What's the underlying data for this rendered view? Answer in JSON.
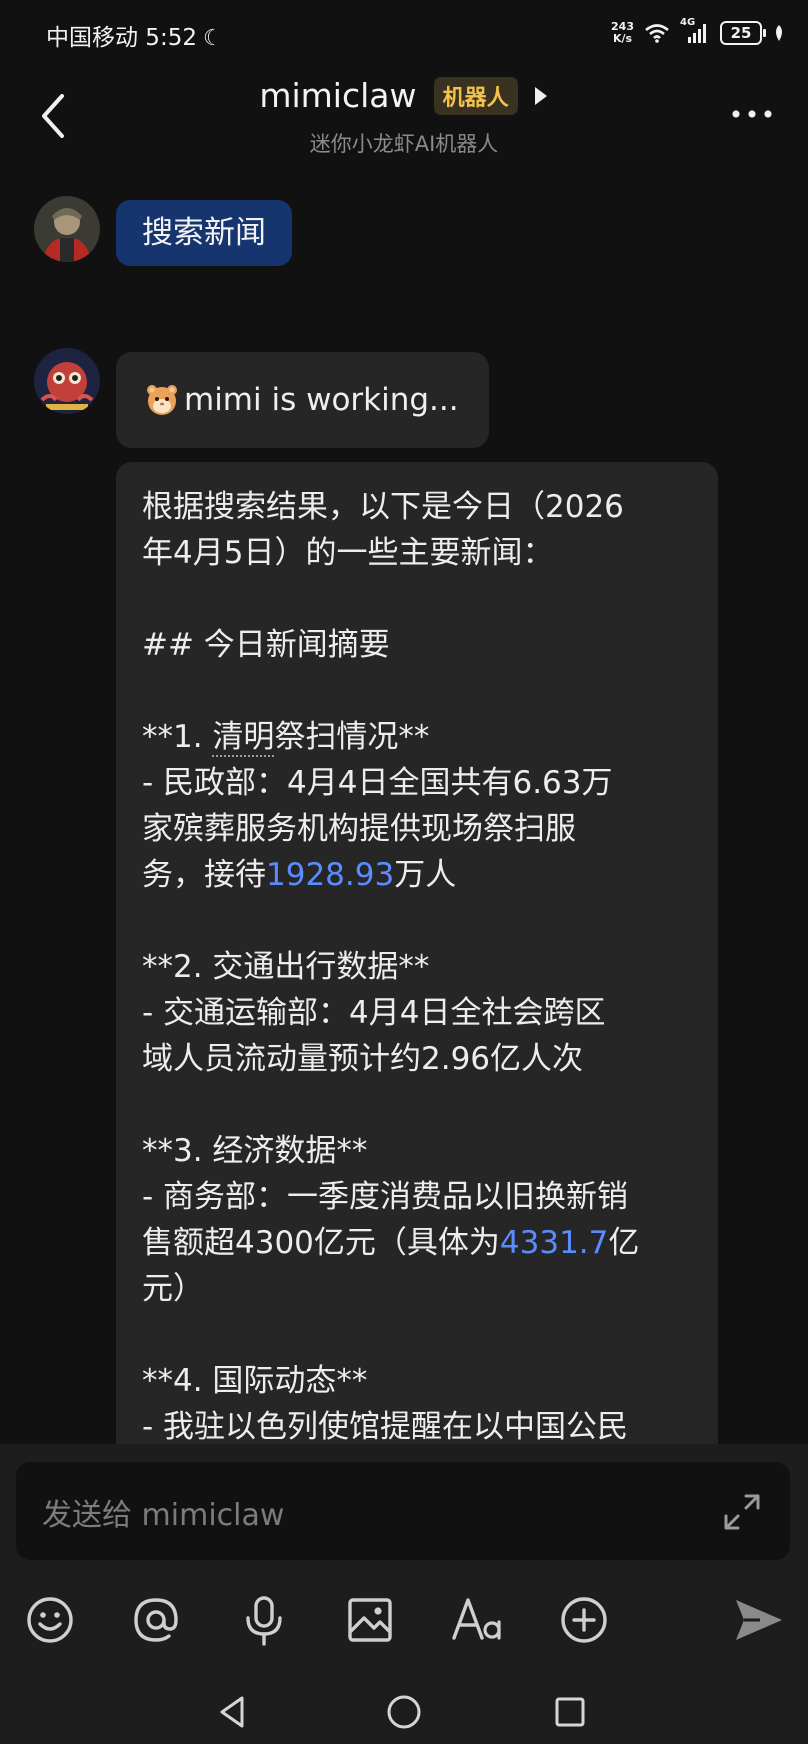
{
  "status_bar": {
    "carrier_time": "中国移动 5:52",
    "net_speed_value": "243",
    "net_speed_unit": "K/s",
    "network": "4G",
    "battery": "25"
  },
  "header": {
    "title": "mimiclaw",
    "tag": "机器人",
    "subtitle": "迷你小龙虾AI机器人"
  },
  "messages": {
    "user_message": "搜索新闻",
    "status_message": "mimi is working...",
    "reply": {
      "l1": "根据搜索结果，以下是今日（2026",
      "l2": "年4月5日）的一些主要新闻：",
      "heading": "## 今日新闻摘要",
      "s1_prefix": "**1. ",
      "s1_title_underlined": "清明",
      "s1_title_rest": "祭扫情况**",
      "s1_l1": "- 民政部：4月4日全国共有6.63万",
      "s1_l2": "家殡葬服务机构提供现场祭扫服",
      "s1_l3_a": "务，接待",
      "s1_l3_num": "1928.93",
      "s1_l3_b": "万人",
      "s2_title": "**2. 交通出行数据**",
      "s2_l1": "- 交通运输部：4月4日全社会跨区",
      "s2_l2": "域人员流动量预计约2.96亿人次",
      "s3_title": "**3. 经济数据**",
      "s3_l1": "- 商务部：一季度消费品以旧换新销",
      "s3_l2_a": "售额超4300亿元（具体为",
      "s3_l2_num": "4331.7",
      "s3_l2_b": "亿",
      "s3_l3": "元）",
      "s4_title": "**4. 国际动态**",
      "s4_l1": "- 我驻以色列使馆提醒在以中国公民"
    }
  },
  "composer": {
    "placeholder": "发送给 mimiclaw"
  },
  "icons": {
    "back": "back-arrow-icon",
    "more": "more-icon",
    "play": "play-icon",
    "expand": "expand-icon",
    "emoji": "emoji-icon",
    "mention": "at-icon",
    "voice": "microphone-icon",
    "image": "image-icon",
    "font": "font-icon",
    "plus": "plus-icon",
    "send": "send-icon"
  },
  "colors": {
    "user_bubble": "#16356e",
    "bot_bubble": "#262626",
    "tag_text": "#f2c14e",
    "link_number": "#5b8cff"
  }
}
